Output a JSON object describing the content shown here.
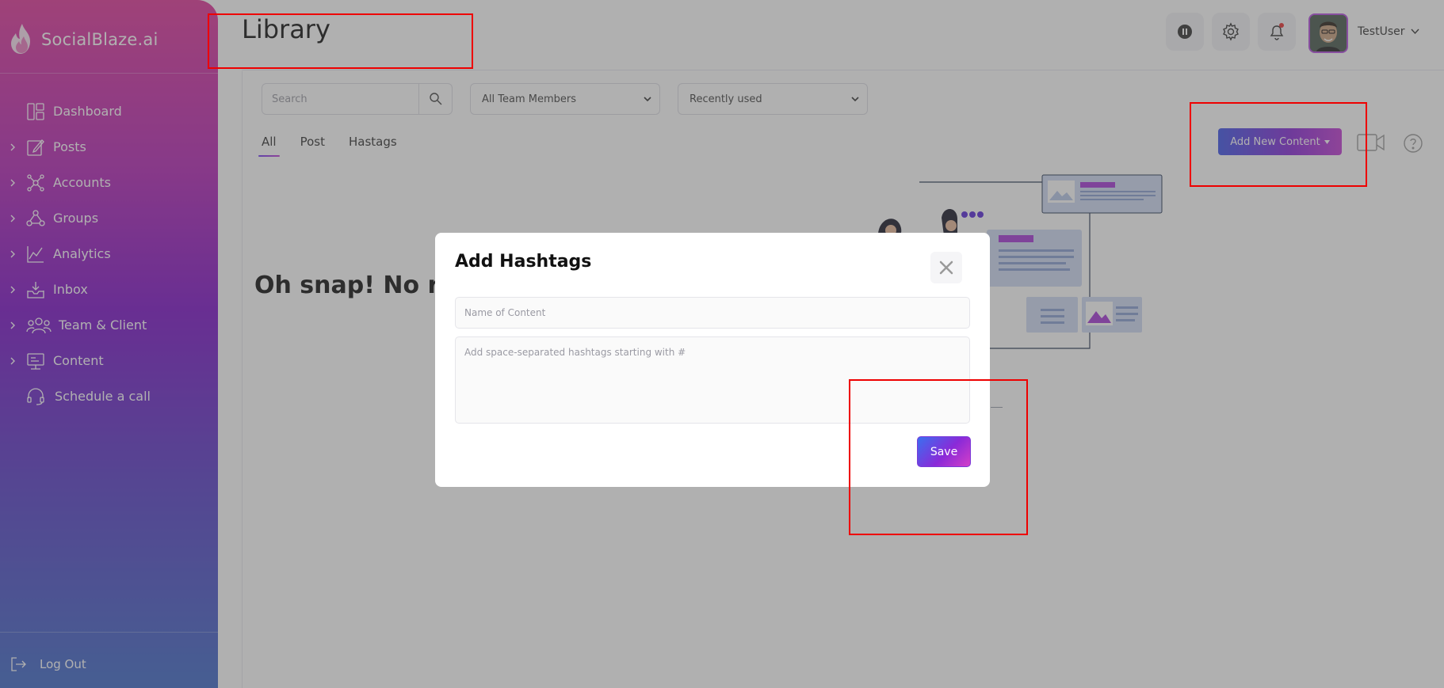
{
  "brand": {
    "name": "SocialBlaze.ai"
  },
  "sidebar": {
    "items": [
      {
        "label": "Dashboard",
        "icon": "dashboard-icon",
        "expandable": false
      },
      {
        "label": "Posts",
        "icon": "edit-icon",
        "expandable": true
      },
      {
        "label": "Accounts",
        "icon": "network-icon",
        "expandable": true
      },
      {
        "label": "Groups",
        "icon": "groups-icon",
        "expandable": true
      },
      {
        "label": "Analytics",
        "icon": "analytics-icon",
        "expandable": true
      },
      {
        "label": "Inbox",
        "icon": "inbox-icon",
        "expandable": true
      },
      {
        "label": "Team & Client",
        "icon": "team-icon",
        "expandable": true
      },
      {
        "label": "Content",
        "icon": "content-icon",
        "expandable": true
      },
      {
        "label": "Schedule a call",
        "icon": "headset-icon",
        "expandable": false
      }
    ],
    "logout_label": "Log Out"
  },
  "header": {
    "title": "Library",
    "username": "TestUser"
  },
  "toolbar": {
    "search_placeholder": "Search",
    "team_filter": "All Team Members",
    "sort_filter": "Recently used",
    "add_button_label": "Add New Content"
  },
  "tabs": [
    {
      "label": "All",
      "active": true
    },
    {
      "label": "Post",
      "active": false
    },
    {
      "label": "Hastags",
      "active": false
    }
  ],
  "empty_state": {
    "message": "Oh snap! No res"
  },
  "modal": {
    "title": "Add Hashtags",
    "name_placeholder": "Name of Content",
    "tags_placeholder": "Add space-separated hashtags starting with #",
    "save_label": "Save"
  },
  "colors": {
    "accent_purple": "#8a2ad8",
    "accent_pink": "#d43fc8",
    "accent_blue": "#3a6ff0",
    "annotation_red": "#ee0000"
  }
}
